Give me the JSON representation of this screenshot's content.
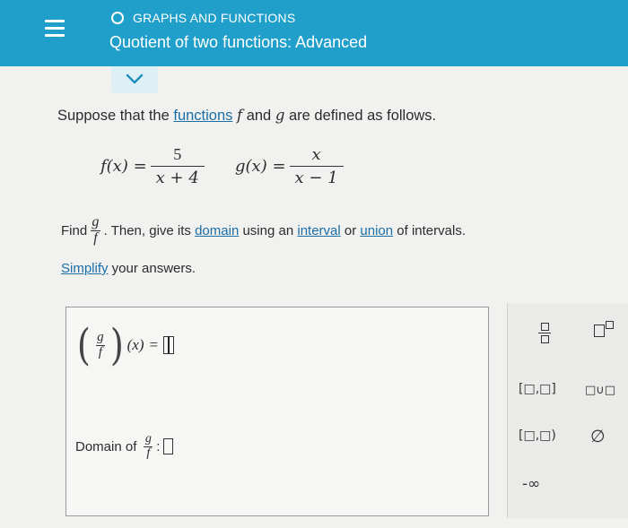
{
  "header": {
    "section": "GRAPHS AND FUNCTIONS",
    "title": "Quotient of two functions: Advanced"
  },
  "problem": {
    "intro_prefix": "Suppose that the ",
    "functions_link": "functions",
    "intro_f": "f",
    "intro_and": " and ",
    "intro_g": "g",
    "intro_suffix": " are defined as follows.",
    "f_lhs": "f(x) =",
    "f_num": "5",
    "f_den": "x + 4",
    "g_lhs": "g(x) =",
    "g_num": "x",
    "g_den": "x − 1",
    "find": "Find",
    "frac_num": "g",
    "frac_den": "f",
    "then_text": ". Then, give its ",
    "domain_link": "domain",
    "using_text": " using an ",
    "interval_link": "interval",
    "or_text": " or ",
    "union_link": "union",
    "of_text": " of intervals.",
    "simplify_link": "Simplify",
    "simplify_rest": " your answers."
  },
  "answer": {
    "expr_num": "g",
    "expr_den": "f",
    "x_arg": "(x)",
    "equals": "=",
    "domain_label": "Domain of",
    "domain_colon": ":"
  },
  "keypad": {
    "closed": "[□,□]",
    "union": "□∪□",
    "halfopen": "[□,□)",
    "empty": "∅",
    "neg_inf": "-∞"
  }
}
